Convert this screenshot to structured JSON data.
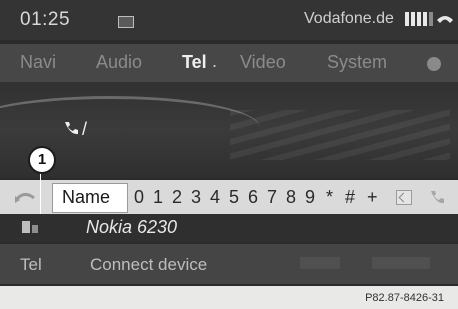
{
  "status": {
    "time": "01:25",
    "carrier": "Vodafone.de",
    "icons": [
      "sms-icon",
      "signal-strength-icon",
      "handset-icon"
    ]
  },
  "menu": {
    "items": [
      {
        "label": "Navi",
        "active": false
      },
      {
        "label": "Audio",
        "active": false
      },
      {
        "label": "Tel",
        "active": true
      },
      {
        "label": "Video",
        "active": false
      },
      {
        "label": "System",
        "active": false
      }
    ],
    "active_marker": "."
  },
  "dial": {
    "input_value": "/"
  },
  "callout": {
    "number": "1"
  },
  "charbar": {
    "name_label": "Name",
    "characters": [
      "0",
      "1",
      "2",
      "3",
      "4",
      "5",
      "6",
      "7",
      "8",
      "9",
      "*",
      "#",
      "+"
    ],
    "icons": [
      "back-icon",
      "clear-icon",
      "call-icon"
    ]
  },
  "device": {
    "name": "Nokia 6230"
  },
  "bottom": {
    "tel_label": "Tel",
    "connect_label": "Connect device"
  },
  "reference": "P82.87-8426-31"
}
